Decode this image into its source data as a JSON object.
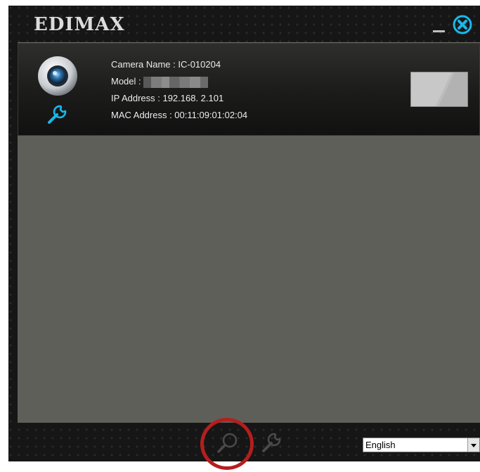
{
  "app": {
    "logo_text": "EDIMAX"
  },
  "device": {
    "camera_name_label": "Camera Name : IC-010204",
    "model_label": "Model :",
    "ip_label": "IP Address : 192.168.  2.101",
    "mac_label": "MAC Address : 00:11:09:01:02:04"
  },
  "language": {
    "selected": "English"
  },
  "icons": {
    "camera": "webcam-icon",
    "device_settings": "wrench-icon",
    "search": "magnifier-icon",
    "tools": "wrench-icon",
    "close": "circle-x-icon",
    "minimize": "minimize-icon"
  },
  "colors": {
    "accent": "#19b8ea",
    "highlight": "#b51e1e"
  }
}
